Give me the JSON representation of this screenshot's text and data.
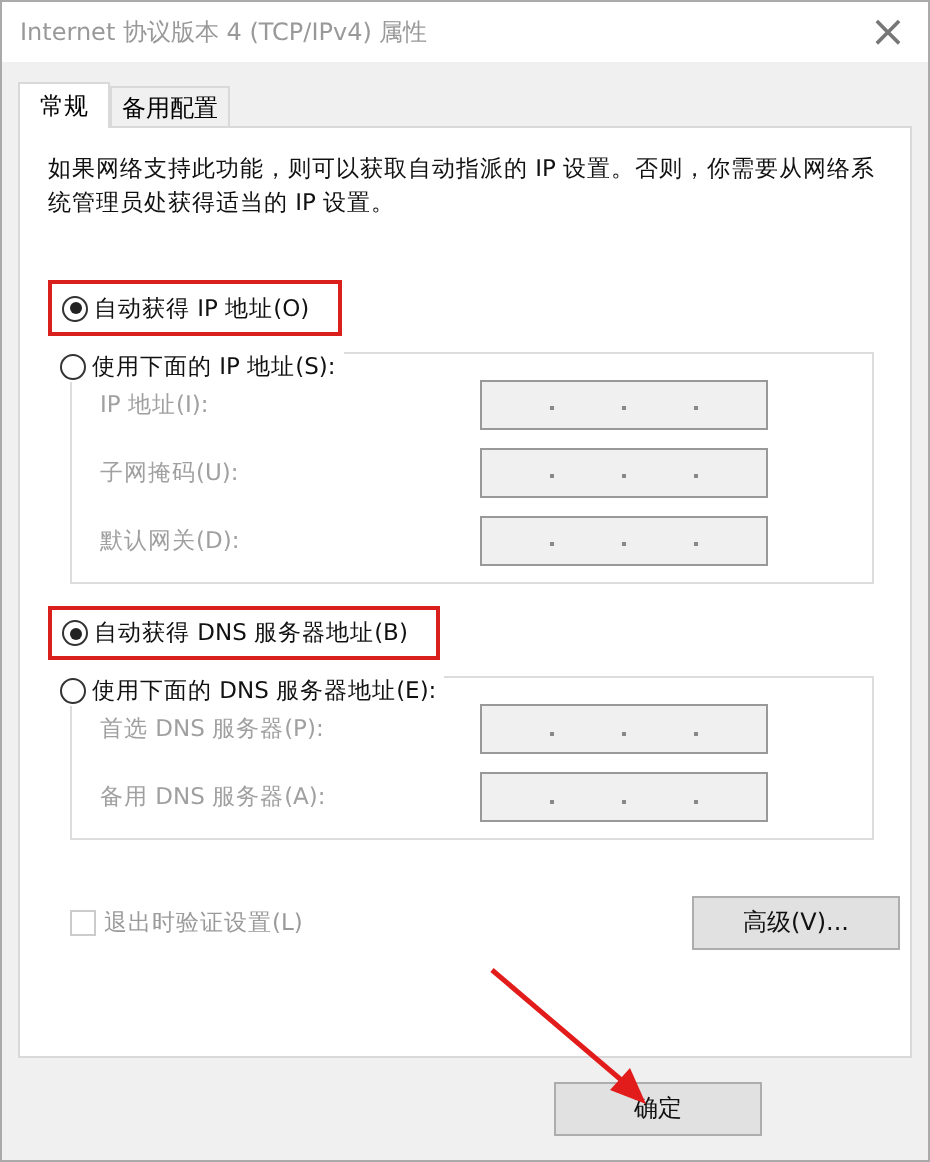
{
  "window": {
    "title": "Internet 协议版本 4 (TCP/IPv4) 属性",
    "close": "×"
  },
  "tabs": [
    {
      "label": "常规",
      "selected": true
    },
    {
      "label": "备用配置",
      "selected": false
    }
  ],
  "description": "如果网络支持此功能，则可以获取自动指派的 IP 设置。否则，你需要从网络系统管理员处获得适当的 IP 设置。",
  "sections": [
    {
      "auto_option": {
        "label": "自动获得 IP 地址(O)",
        "selected": true,
        "highlighted": true
      },
      "manual_option": {
        "label": "使用下面的 IP 地址(S):",
        "selected": false
      },
      "fields": [
        {
          "label": "IP 地址(I):",
          "disabled": true
        },
        {
          "label": "子网掩码(U):",
          "disabled": true
        },
        {
          "label": "默认网关(D):",
          "disabled": true
        }
      ]
    },
    {
      "auto_option": {
        "label": "自动获得 DNS 服务器地址(B)",
        "selected": true,
        "highlighted": true
      },
      "manual_option": {
        "label": "使用下面的 DNS 服务器地址(E):",
        "selected": false
      },
      "fields": [
        {
          "label": "首选 DNS 服务器(P):",
          "disabled": true
        },
        {
          "label": "备用 DNS 服务器(A):",
          "disabled": true
        }
      ]
    }
  ],
  "validate_checkbox": {
    "label": "退出时验证设置(L)",
    "checked": false,
    "disabled": true
  },
  "advanced_button": "高级(V)...",
  "ok_button": "确定",
  "annotation_arrow": true
}
